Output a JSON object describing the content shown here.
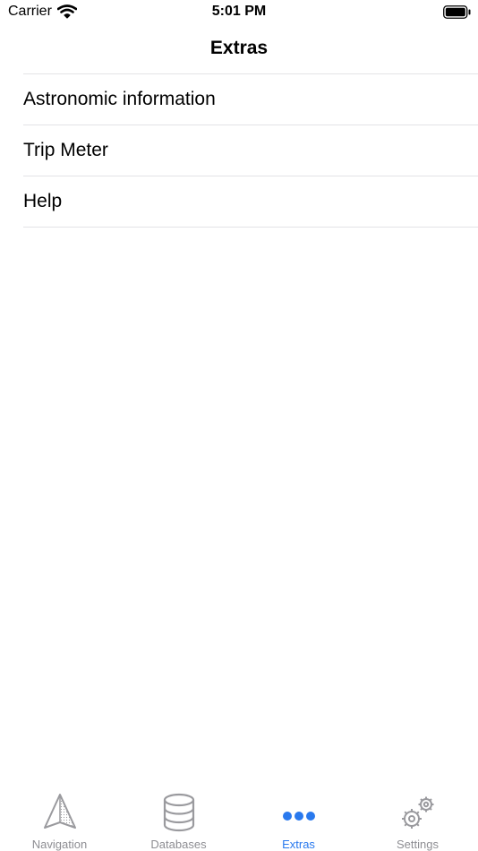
{
  "status_bar": {
    "carrier": "Carrier",
    "time": "5:01 PM"
  },
  "header": {
    "title": "Extras"
  },
  "list": {
    "items": [
      {
        "label": "Astronomic information"
      },
      {
        "label": "Trip Meter"
      },
      {
        "label": "Help"
      }
    ]
  },
  "tab_bar": {
    "tabs": [
      {
        "label": "Navigation",
        "icon": "navigation-arrow-icon",
        "selected": false
      },
      {
        "label": "Databases",
        "icon": "database-icon",
        "selected": false
      },
      {
        "label": "Extras",
        "icon": "more-dots-icon",
        "selected": true
      },
      {
        "label": "Settings",
        "icon": "gears-icon",
        "selected": false
      }
    ]
  },
  "colors": {
    "accent": "#2979ee",
    "inactive": "#8e8e93",
    "separator": "#e3e3e6"
  }
}
